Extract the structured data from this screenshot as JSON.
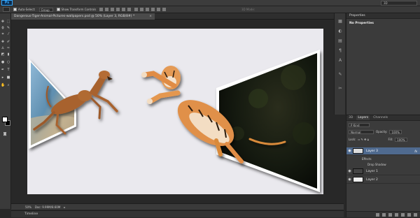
{
  "app": {
    "logo": "Ps",
    "workspace": "3D"
  },
  "options": {
    "auto_select_label": "Auto-Select:",
    "auto_select_value": "Group",
    "transform_label": "Show Transform Controls",
    "mode_3d": "3D Mode:"
  },
  "document": {
    "tab_title": "Dangerous-Tiger-Animal-Pictures-wallpapers.psd @ 50% (Layer 3, RGB/8#) *",
    "tab_close": "×"
  },
  "status": {
    "zoom": "50%",
    "doc_info": "Doc: 9.99M/8.60M",
    "arrow": "▸"
  },
  "timeline": {
    "label": "Timeline"
  },
  "properties": {
    "header": "Properties",
    "title": "No Properties"
  },
  "layers_panel": {
    "tabs": [
      "3D",
      "Layers",
      "Channels"
    ],
    "filter": "P Kind",
    "blend_mode": "Normal",
    "opacity_label": "Opacity:",
    "opacity_value": "100%",
    "lock_label": "Lock:",
    "fill_label": "Fill:",
    "fill_value": "100%",
    "layers": [
      {
        "name": "Layer 3",
        "fx": "fx"
      },
      {
        "name": "Layer 1"
      },
      {
        "name": "Layer 2"
      }
    ],
    "effects_label": "Effects",
    "effect_item": "Drop Shadow"
  },
  "icons": [
    "move-tool-icon",
    "marquee-icon",
    "lasso-icon",
    "quick-select-icon",
    "crop-icon",
    "eyedropper-icon",
    "healing-brush-icon",
    "brush-icon",
    "clone-stamp-icon",
    "history-brush-icon",
    "eraser-icon",
    "gradient-icon",
    "blur-icon",
    "dodge-icon",
    "pen-icon",
    "type-icon",
    "path-select-icon",
    "shape-icon",
    "hand-icon",
    "zoom-icon"
  ],
  "colors": {
    "accent": "#4f6a8f",
    "canvas": "#eae9ee",
    "panel": "#3b3b3b"
  }
}
